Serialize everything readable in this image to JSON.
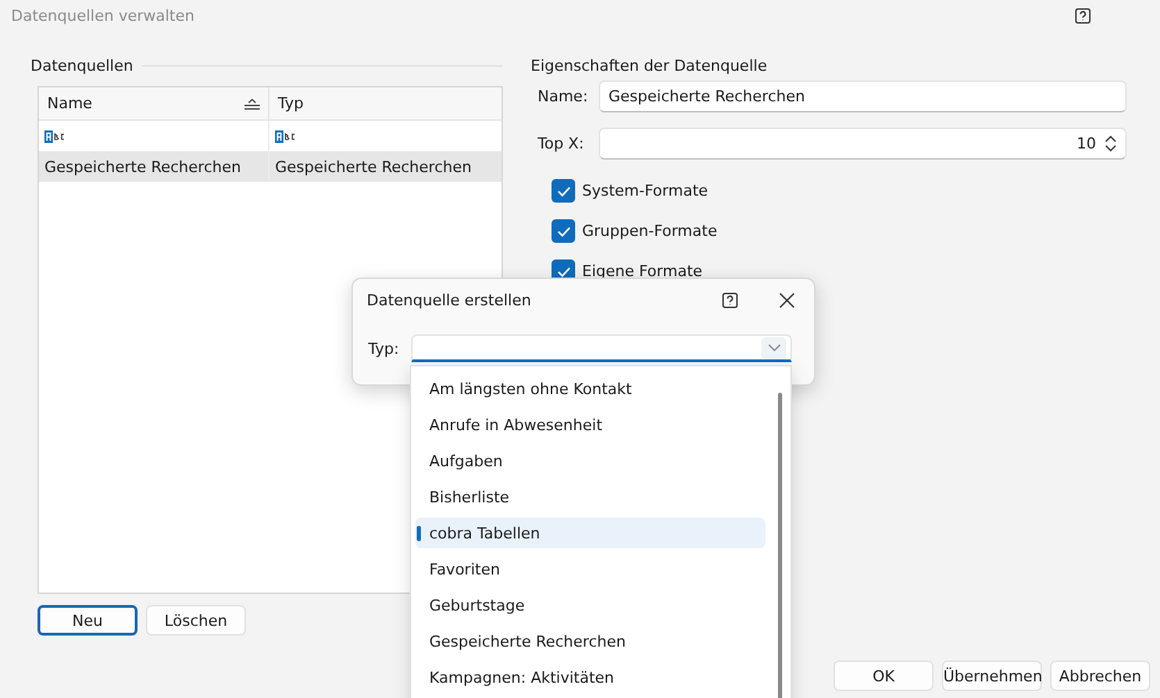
{
  "window": {
    "title": "Datenquellen verwalten"
  },
  "data_sources": {
    "title": "Datenquellen",
    "columns": [
      {
        "label": "Name",
        "sorted": true
      },
      {
        "label": "Typ",
        "sorted": false
      }
    ],
    "rows": [
      {
        "selected": false,
        "cells": [
          {
            "kind": "icon"
          },
          {
            "kind": "icon"
          }
        ]
      },
      {
        "selected": true,
        "cells": [
          {
            "kind": "text",
            "text": "Gespeicherte Recherchen"
          },
          {
            "kind": "text",
            "text": "Gespeicherte Recherchen"
          }
        ]
      }
    ],
    "buttons": [
      {
        "label": "Neu",
        "focused": true
      },
      {
        "label": "Löschen",
        "focused": false
      }
    ]
  },
  "properties": {
    "title": "Eigenschaften der Datenquelle",
    "name_label": "Name:",
    "name_value": "Gespeicherte Recherchen",
    "topx_label": "Top X:",
    "topx_value": "10",
    "checkboxes": [
      {
        "label": "System-Formate",
        "checked": true
      },
      {
        "label": "Gruppen-Formate",
        "checked": true
      },
      {
        "label": "Eigene Formate",
        "checked": true
      }
    ]
  },
  "dialog": {
    "title": "Datenquelle erstellen",
    "type_label": "Typ:",
    "options": [
      {
        "label": "Am längsten ohne Kontakt",
        "selected": false
      },
      {
        "label": "Anrufe in Abwesenheit",
        "selected": false
      },
      {
        "label": "Aufgaben",
        "selected": false
      },
      {
        "label": "Bisherliste",
        "selected": false
      },
      {
        "label": "cobra Tabellen",
        "selected": true
      },
      {
        "label": "Favoriten",
        "selected": false
      },
      {
        "label": "Geburtstage",
        "selected": false
      },
      {
        "label": "Gespeicherte Recherchen",
        "selected": false
      },
      {
        "label": "Kampagnen: Aktivitäten",
        "selected": false
      }
    ]
  },
  "footer_buttons": [
    {
      "label": "OK"
    },
    {
      "label": "Übernehmen"
    },
    {
      "label": "Abbrechen"
    }
  ]
}
